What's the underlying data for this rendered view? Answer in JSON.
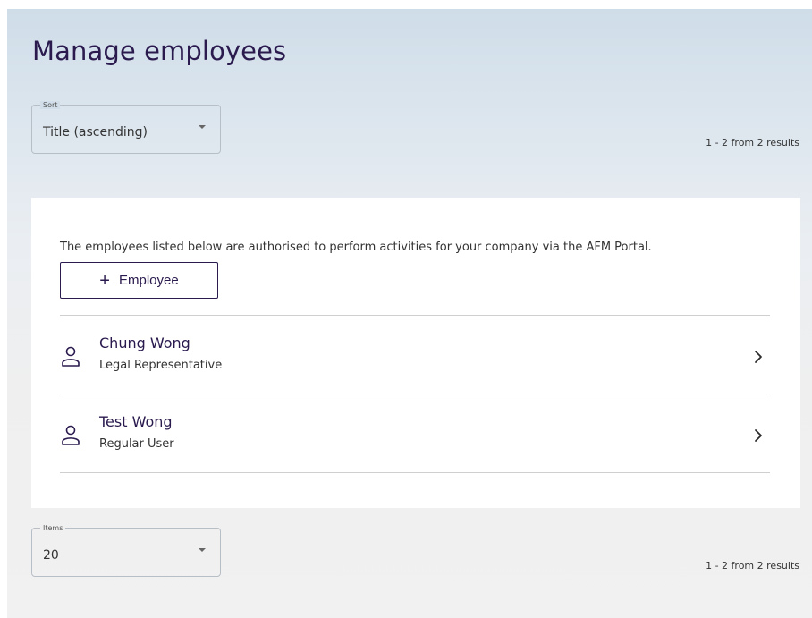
{
  "page": {
    "title": "Manage employees"
  },
  "sort": {
    "label": "Sort",
    "value": "Title (ascending)",
    "results_text": "1 - 2 from 2 results"
  },
  "card": {
    "intro": "The employees listed below are authorised to perform activities for your company via the AFM Portal.",
    "add_button": {
      "icon": "plus-icon",
      "label": "Employee"
    },
    "employees": [
      {
        "name": "Chung Wong",
        "role": "Legal Representative",
        "icon": "person-icon"
      },
      {
        "name": "Test Wong",
        "role": "Regular User",
        "icon": "person-icon"
      }
    ]
  },
  "items": {
    "label": "Items",
    "value": "20",
    "results_text": "1 - 2 from 2 results"
  },
  "colors": {
    "brand": "#2a1a4e",
    "divider": "#cfcfcf"
  }
}
